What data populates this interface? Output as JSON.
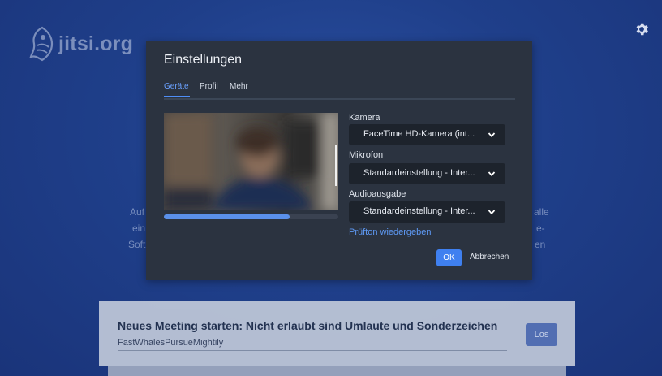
{
  "app": {
    "logo_text": "jitsi.org"
  },
  "background_text": {
    "left_lines": [
      "Auf",
      "ein",
      "Soft"
    ],
    "right_lines": [
      "alle",
      "e-",
      "en"
    ]
  },
  "dialog": {
    "title": "Einstellungen",
    "tabs": [
      {
        "label": "Geräte",
        "active": true
      },
      {
        "label": "Profil",
        "active": false
      },
      {
        "label": "Mehr",
        "active": false
      }
    ],
    "audio_level": 0.72,
    "camera": {
      "label": "Kamera",
      "value": "FaceTime HD-Kamera (int..."
    },
    "microphone": {
      "label": "Mikrofon",
      "value": "Standardeinstellung - Inter..."
    },
    "audio_output": {
      "label": "Audioausgabe",
      "value": "Standardeinstellung - Inter..."
    },
    "test_sound_link": "Prüfton wiedergeben",
    "ok_label": "OK",
    "cancel_label": "Abbrechen"
  },
  "meeting": {
    "title": "Neues Meeting starten: Nicht erlaubt sind Umlaute und Sonderzeichen",
    "room_name": "FastWhalesPursueMightily",
    "go_label": "Los"
  },
  "icons": {
    "logo": "jitsi-logo-icon",
    "settings": "gear-icon",
    "dropdown": "chevron-down-icon"
  },
  "colors": {
    "background": "#1e3d85",
    "dialog": "#2b3340",
    "accent": "#3f80f0",
    "link": "#5e9af6"
  }
}
